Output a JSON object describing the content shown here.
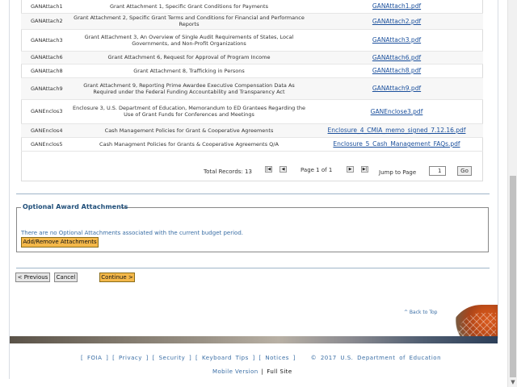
{
  "attachments": [
    {
      "code": "GANAttach1",
      "description": "Grant Attachment 1, Specific Grant Conditions for Payments",
      "file": "GANAttach1.pdf"
    },
    {
      "code": "GANAttach2",
      "description": "Grant Attachment 2, Specific Grant Terms and Conditions for Financial and Performance Reports",
      "file": "GANAttach2.pdf"
    },
    {
      "code": "GANAttach3",
      "description": "Grant Attachment 3, An Overview of Single Audit Requirements of States, Local Governments, and Non-Profit Organizations",
      "file": "GANAttach3.pdf"
    },
    {
      "code": "GANAttach6",
      "description": "Grant Attachment 6, Request for Approval of Program Income",
      "file": "GANAttach6.pdf"
    },
    {
      "code": "GANAttach8",
      "description": "Grant Attachment 8, Trafficking in Persons",
      "file": "GANAttach8.pdf"
    },
    {
      "code": "GANAttach9",
      "description": "Grant Attachment 9, Reporting Prime Awardee Executive Compensation Data As Required under the Federal Funding Accountability and Transparency Act",
      "file": "GANAttach9.pdf"
    },
    {
      "code": "GANEnclos3",
      "description": "Enclosure 3, U.S. Department of Education, Memorandum to ED Grantees Regarding the Use of Grant Funds for Conferences and Meetings",
      "file": "GANEnclose3.pdf"
    },
    {
      "code": "GANEnclos4",
      "description": "Cash Management Policies for Grant & Cooperative Agreements",
      "file": "Enclosure_4_CMIA_memo_signed_7.12.16.pdf"
    },
    {
      "code": "GANEnclos5",
      "description": "Cash Managment Policies for Grants & Cooperative Agreements Q/A",
      "file": "Enclosure_5_Cash_Management_FAQs.pdf"
    }
  ],
  "pager": {
    "total_records": "Total Records: 13",
    "page_of": "Page 1 of 1",
    "jump_label": "Jump to Page",
    "jump_value": "1",
    "go_label": "Go",
    "first": "|◀",
    "prev": "◀",
    "next": "▶",
    "last": "▶|"
  },
  "optional": {
    "legend": "Optional Award Attachments",
    "message": "There are no Optional Attachments associated with the current budget period.",
    "button": "Add/Remove Attachments"
  },
  "nav": {
    "previous": "< Previous",
    "cancel": "Cancel",
    "continue": "Continue >"
  },
  "back_to_top": "^ Back to Top",
  "footer": {
    "links": [
      "FOIA",
      "Privacy",
      "Security",
      "Keyboard Tips",
      "Notices"
    ],
    "copyright": "© 2017 U.S. Department of Education",
    "mobile": "Mobile Version",
    "full": "Full Site"
  },
  "colors": {
    "link": "#1a4f9c",
    "accent_button": "#f4b84a",
    "legend": "#1f4e79"
  }
}
